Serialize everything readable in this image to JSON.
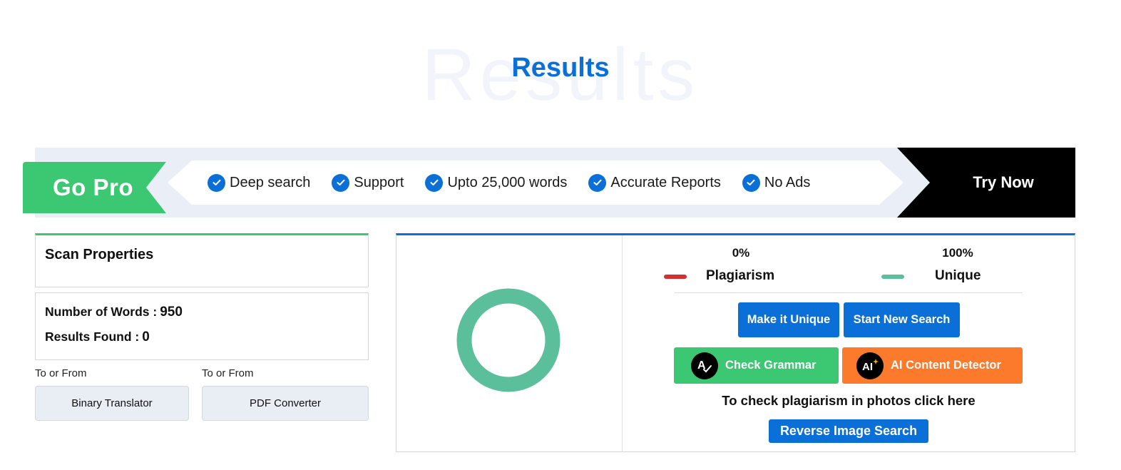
{
  "page": {
    "title": "Results",
    "title_watermark": "Results"
  },
  "banner": {
    "gopro_label": "Go Pro",
    "features": [
      {
        "icon": "check-circle-icon",
        "label": "Deep search"
      },
      {
        "icon": "check-circle-icon",
        "label": "Support"
      },
      {
        "icon": "check-circle-icon",
        "label": "Upto 25,000 words"
      },
      {
        "icon": "check-circle-icon",
        "label": "Accurate Reports"
      },
      {
        "icon": "check-circle-icon",
        "label": "No Ads"
      }
    ],
    "cta_label": "Try Now",
    "colors": {
      "gopro": "#3cc873",
      "cta_bg": "#000000",
      "check": "#0b6fd8"
    }
  },
  "scan": {
    "heading": "Scan Properties",
    "words_label": "Number of Words :",
    "words_value": "950",
    "results_label": "Results Found :",
    "results_value": "0"
  },
  "tools": [
    {
      "caption": "To or From",
      "button": "Binary Translator"
    },
    {
      "caption": "To or From",
      "button": "PDF Converter"
    }
  ],
  "results": {
    "plagiarism": {
      "percent_label": "0%",
      "name": "Plagiarism",
      "color": "#d32f2f",
      "value": 0
    },
    "unique": {
      "percent_label": "100%",
      "name": "Unique",
      "color": "#5bbf9b",
      "value": 100
    },
    "make_unique_label": "Make it Unique",
    "new_search_label": "Start New Search",
    "grammar_label": "Check Grammar",
    "ai_detector_label": "AI Content Detector",
    "photo_text": "To check plagiarism in photos click here",
    "reverse_label": "Reverse Image Search"
  }
}
